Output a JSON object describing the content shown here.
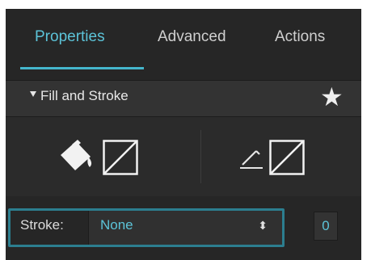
{
  "tabs": [
    {
      "label": "Properties",
      "active": true
    },
    {
      "label": "Advanced",
      "active": false
    },
    {
      "label": "Actions",
      "active": false
    }
  ],
  "section": {
    "title": "Fill and Stroke",
    "favorite_icon": "star-icon",
    "collapse_icon": "caret-down-icon"
  },
  "icons": {
    "fill": "paint-bucket-icon",
    "fill_swatch": "no-color-swatch",
    "stroke": "pencil-icon",
    "stroke_swatch": "no-color-swatch"
  },
  "stroke": {
    "label": "Stroke:",
    "value": "None",
    "width": "0"
  },
  "colors": {
    "panel_bg": "#262626",
    "accent": "#5cc3d8",
    "highlight": "#2c7e8f"
  }
}
